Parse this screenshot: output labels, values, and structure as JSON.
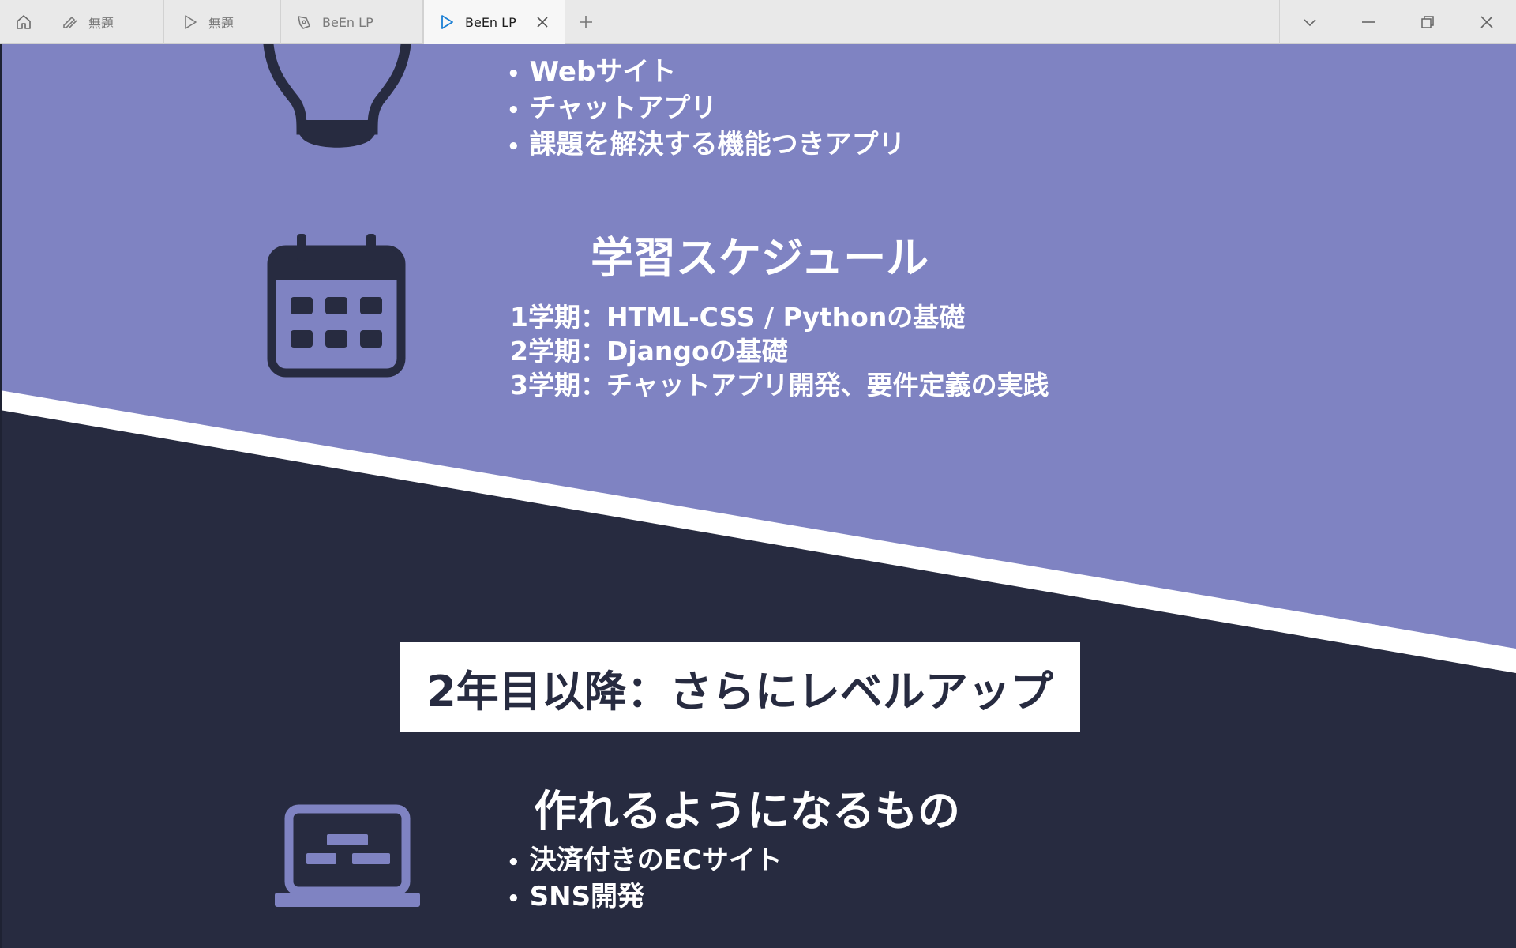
{
  "tabs": [
    {
      "label": "無題",
      "icon": "pen-icon"
    },
    {
      "label": "無題",
      "icon": "play-icon"
    },
    {
      "label": "BeEn LP",
      "icon": "pen-nib-icon"
    },
    {
      "label": "BeEn LP",
      "icon": "play-icon",
      "active": true
    }
  ],
  "colors": {
    "accent": "#7f83c2",
    "dark": "#272b40",
    "white": "#ffffff",
    "icon_dark": "#272b40",
    "icon_light": "#7f83c2"
  },
  "section1": {
    "items": [
      "Webサイト",
      "チャットアプリ",
      "課題を解決する機能つきアプリ"
    ]
  },
  "schedule": {
    "title": "学習スケジュール",
    "lines": [
      "1学期：HTML-CSS / Pythonの基礎",
      "2学期：Djangoの基礎",
      "3学期：チャットアプリ開発、要件定義の実践"
    ]
  },
  "banner": {
    "text": "2年目以降：さらにレベルアップ"
  },
  "section2": {
    "title": "作れるようになるもの",
    "items": [
      "決済付きのECサイト",
      "SNS開発"
    ]
  }
}
